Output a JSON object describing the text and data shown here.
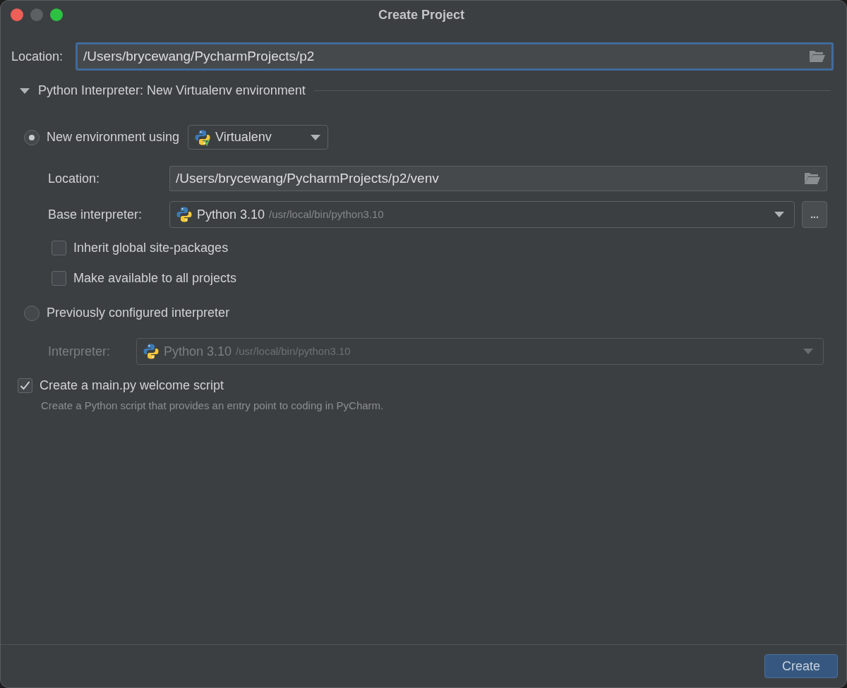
{
  "window": {
    "title": "Create Project"
  },
  "location": {
    "label": "Location:",
    "value": "/Users/brycewang/PycharmProjects/p2"
  },
  "section": {
    "title": "Python Interpreter: New Virtualenv environment",
    "expanded": true
  },
  "new_environment": {
    "label": "New environment using",
    "selected": true,
    "tool": "Virtualenv",
    "location": {
      "label": "Location:",
      "value": "/Users/brycewang/PycharmProjects/p2/venv"
    },
    "base_interpreter": {
      "label": "Base interpreter:",
      "name": "Python 3.10",
      "path": "/usr/local/bin/python3.10",
      "browse": "..."
    },
    "checkboxes": [
      {
        "label": "Inherit global site-packages",
        "checked": false
      },
      {
        "label": "Make available to all projects",
        "checked": false
      }
    ]
  },
  "previous_interpreter": {
    "label": "Previously configured interpreter",
    "selected": false,
    "interpreter": {
      "label": "Interpreter:",
      "name": "Python 3.10",
      "path": "/usr/local/bin/python3.10",
      "disabled": true
    }
  },
  "welcome_script": {
    "label": "Create a main.py welcome script",
    "checked": true,
    "description": "Create a Python script that provides an entry point to coding in PyCharm."
  },
  "buttons": [
    {
      "label": "Create",
      "kind": "primary"
    }
  ]
}
